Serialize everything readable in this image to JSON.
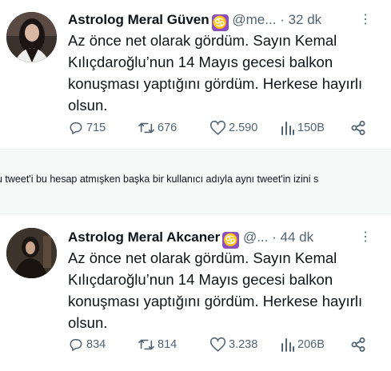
{
  "tweets": [
    {
      "name": "Astrolog Meral Güven",
      "badge": "♋",
      "handle": "@me...",
      "dot": "·",
      "time": "32 dk",
      "more": "⋮",
      "text": "Az önce net olarak gördüm. Sayın Kemal\nKılıçdaroğlu’nun 14 Mayıs gecesi balkon\nkonuşması yaptığını gördüm. Herkese hayırlı\nolsun.",
      "replies": "715",
      "retweets": "676",
      "likes": "2.590",
      "views": "150B"
    },
    {
      "name": "Astrolog Meral Akcaner",
      "badge": "♋",
      "handle": "@...",
      "dot": "·",
      "time": "44 dk",
      "more": "⋮",
      "text": "Az önce net olarak gördüm. Sayın Kemal\nKılıçdaroğlu’nun 14 Mayıs gecesi balkon\nkonuşması yaptığını gördüm. Herkese hayırlı\nolsun.",
      "replies": "834",
      "retweets": "814",
      "likes": "3.238",
      "views": "206B"
    }
  ],
  "caption": "u tweet'i bu hesap atmışken başka bir kullanıcı adıyla aynı tweet'in izini s",
  "colors": {
    "text": "#0f1419",
    "muted": "#536471",
    "badge": "#8a4fc0"
  },
  "icons": [
    "reply-icon",
    "retweet-icon",
    "like-icon",
    "views-icon",
    "share-icon",
    "more-icon",
    "zodiac-cancer-icon"
  ]
}
